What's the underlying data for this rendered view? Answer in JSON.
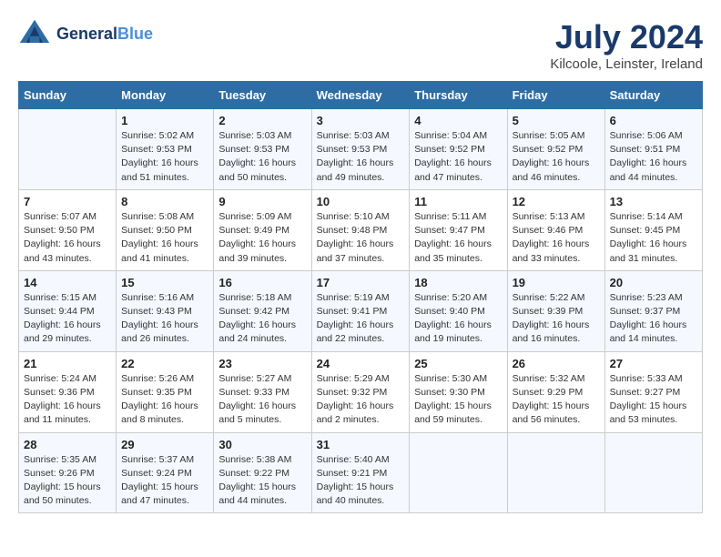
{
  "header": {
    "logo_line1": "General",
    "logo_line2": "Blue",
    "month_year": "July 2024",
    "location": "Kilcoole, Leinster, Ireland"
  },
  "days_of_week": [
    "Sunday",
    "Monday",
    "Tuesday",
    "Wednesday",
    "Thursday",
    "Friday",
    "Saturday"
  ],
  "weeks": [
    [
      {
        "day": "",
        "data": ""
      },
      {
        "day": "1",
        "data": "Sunrise: 5:02 AM\nSunset: 9:53 PM\nDaylight: 16 hours\nand 51 minutes."
      },
      {
        "day": "2",
        "data": "Sunrise: 5:03 AM\nSunset: 9:53 PM\nDaylight: 16 hours\nand 50 minutes."
      },
      {
        "day": "3",
        "data": "Sunrise: 5:03 AM\nSunset: 9:53 PM\nDaylight: 16 hours\nand 49 minutes."
      },
      {
        "day": "4",
        "data": "Sunrise: 5:04 AM\nSunset: 9:52 PM\nDaylight: 16 hours\nand 47 minutes."
      },
      {
        "day": "5",
        "data": "Sunrise: 5:05 AM\nSunset: 9:52 PM\nDaylight: 16 hours\nand 46 minutes."
      },
      {
        "day": "6",
        "data": "Sunrise: 5:06 AM\nSunset: 9:51 PM\nDaylight: 16 hours\nand 44 minutes."
      }
    ],
    [
      {
        "day": "7",
        "data": "Sunrise: 5:07 AM\nSunset: 9:50 PM\nDaylight: 16 hours\nand 43 minutes."
      },
      {
        "day": "8",
        "data": "Sunrise: 5:08 AM\nSunset: 9:50 PM\nDaylight: 16 hours\nand 41 minutes."
      },
      {
        "day": "9",
        "data": "Sunrise: 5:09 AM\nSunset: 9:49 PM\nDaylight: 16 hours\nand 39 minutes."
      },
      {
        "day": "10",
        "data": "Sunrise: 5:10 AM\nSunset: 9:48 PM\nDaylight: 16 hours\nand 37 minutes."
      },
      {
        "day": "11",
        "data": "Sunrise: 5:11 AM\nSunset: 9:47 PM\nDaylight: 16 hours\nand 35 minutes."
      },
      {
        "day": "12",
        "data": "Sunrise: 5:13 AM\nSunset: 9:46 PM\nDaylight: 16 hours\nand 33 minutes."
      },
      {
        "day": "13",
        "data": "Sunrise: 5:14 AM\nSunset: 9:45 PM\nDaylight: 16 hours\nand 31 minutes."
      }
    ],
    [
      {
        "day": "14",
        "data": "Sunrise: 5:15 AM\nSunset: 9:44 PM\nDaylight: 16 hours\nand 29 minutes."
      },
      {
        "day": "15",
        "data": "Sunrise: 5:16 AM\nSunset: 9:43 PM\nDaylight: 16 hours\nand 26 minutes."
      },
      {
        "day": "16",
        "data": "Sunrise: 5:18 AM\nSunset: 9:42 PM\nDaylight: 16 hours\nand 24 minutes."
      },
      {
        "day": "17",
        "data": "Sunrise: 5:19 AM\nSunset: 9:41 PM\nDaylight: 16 hours\nand 22 minutes."
      },
      {
        "day": "18",
        "data": "Sunrise: 5:20 AM\nSunset: 9:40 PM\nDaylight: 16 hours\nand 19 minutes."
      },
      {
        "day": "19",
        "data": "Sunrise: 5:22 AM\nSunset: 9:39 PM\nDaylight: 16 hours\nand 16 minutes."
      },
      {
        "day": "20",
        "data": "Sunrise: 5:23 AM\nSunset: 9:37 PM\nDaylight: 16 hours\nand 14 minutes."
      }
    ],
    [
      {
        "day": "21",
        "data": "Sunrise: 5:24 AM\nSunset: 9:36 PM\nDaylight: 16 hours\nand 11 minutes."
      },
      {
        "day": "22",
        "data": "Sunrise: 5:26 AM\nSunset: 9:35 PM\nDaylight: 16 hours\nand 8 minutes."
      },
      {
        "day": "23",
        "data": "Sunrise: 5:27 AM\nSunset: 9:33 PM\nDaylight: 16 hours\nand 5 minutes."
      },
      {
        "day": "24",
        "data": "Sunrise: 5:29 AM\nSunset: 9:32 PM\nDaylight: 16 hours\nand 2 minutes."
      },
      {
        "day": "25",
        "data": "Sunrise: 5:30 AM\nSunset: 9:30 PM\nDaylight: 15 hours\nand 59 minutes."
      },
      {
        "day": "26",
        "data": "Sunrise: 5:32 AM\nSunset: 9:29 PM\nDaylight: 15 hours\nand 56 minutes."
      },
      {
        "day": "27",
        "data": "Sunrise: 5:33 AM\nSunset: 9:27 PM\nDaylight: 15 hours\nand 53 minutes."
      }
    ],
    [
      {
        "day": "28",
        "data": "Sunrise: 5:35 AM\nSunset: 9:26 PM\nDaylight: 15 hours\nand 50 minutes."
      },
      {
        "day": "29",
        "data": "Sunrise: 5:37 AM\nSunset: 9:24 PM\nDaylight: 15 hours\nand 47 minutes."
      },
      {
        "day": "30",
        "data": "Sunrise: 5:38 AM\nSunset: 9:22 PM\nDaylight: 15 hours\nand 44 minutes."
      },
      {
        "day": "31",
        "data": "Sunrise: 5:40 AM\nSunset: 9:21 PM\nDaylight: 15 hours\nand 40 minutes."
      },
      {
        "day": "",
        "data": ""
      },
      {
        "day": "",
        "data": ""
      },
      {
        "day": "",
        "data": ""
      }
    ]
  ]
}
